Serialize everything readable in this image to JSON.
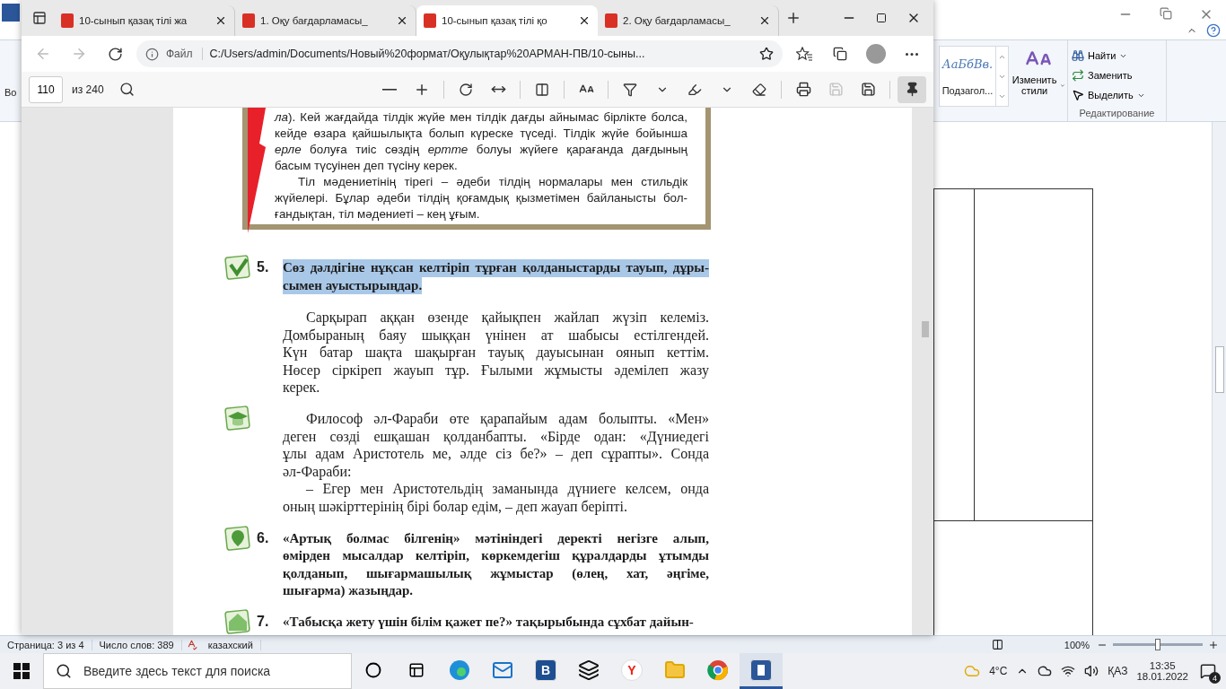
{
  "word": {
    "ribbon": {
      "partial_label": "Во",
      "style_preview": "АаБбВв.",
      "style_name": "Подзагол...",
      "change_styles": "Изменить стили",
      "editing": [
        {
          "label": "Найти",
          "kind": "find",
          "has_menu": true
        },
        {
          "label": "Заменить",
          "kind": "replace",
          "has_menu": false
        },
        {
          "label": "Выделить",
          "kind": "select",
          "has_menu": true
        }
      ],
      "editing_group": "Редактирование"
    }
  },
  "browser": {
    "tabs": [
      {
        "title": "10-сынып қазақ тілі жа",
        "selected": false
      },
      {
        "title": "1. Оқу бағдарламасы_",
        "selected": false
      },
      {
        "title": "10-сынып қазақ тілі қо",
        "selected": true
      },
      {
        "title": "2. Оқу бағдарламасы_",
        "selected": false
      }
    ],
    "address": {
      "label": "Файл",
      "url": "C:/Users/admin/Documents/Новый%20формат/Оқулықтар%20АРМАН-ПВ/10-сыны..."
    },
    "pdf_toolbar": {
      "page": "110",
      "total": "из 240",
      "save_disabled": true,
      "pin_selected": true
    }
  },
  "document": {
    "box_paragraphs": [
      [
        "*ла*). Кей жағдайда тілдік жүйе мен тілдік дағды айнымас бірлікте болса,",
        "кейде өзара қайшылықта болып күреске түседі. Тілдік жүйе бойынша",
        "*ерле* болуға тиіс сөздің *ертте* болуы жүйеге қарағанда дағдының",
        "басым түсуінен деп түсіну керек."
      ],
      [
        "Тіл мәдениетінің тірегі – әдеби тілдің нормалары мен стильдік",
        "жүйелері. Бұлар әдеби тілдің қоғамдық қызметімен байланысты бол-",
        "ғандықтан, тіл мәдениеті – кең ұғым."
      ]
    ],
    "exercises": [
      {
        "kind": "check",
        "number": "5.",
        "highlighted": true,
        "paragraphs": [
          [
            "Сөз дәлдігіне нұқсан келтіріп тұрған қолданыстарды тауып, дұры-",
            "сымен ауыстырыңдар."
          ]
        ]
      },
      {
        "kind": "plain",
        "highlighted": false,
        "paragraphs": [
          [
            "Сарқырап аққан өзенде қайықпен жайлап жүзіп келеміз.",
            "Домбыраның баяу шыққан үнінен ат шабысы естілгендей.",
            "Күн батар шақта шақырған тауық дауысынан оянып кеттім.",
            "Нөсер сіркіреп жауып тұр. Ғылыми жұмысты әдемілеп жазу",
            "керек."
          ]
        ]
      },
      {
        "kind": "cap",
        "highlighted": false,
        "paragraphs": [
          [
            "Философ әл-Фараби өте қарапайым адам болыпты. «Мен»",
            "деген сөзді ешқашан қолданбапты. «Бірде одан: «Дүниедегі",
            "ұлы адам Аристотель ме, әлде сіз бе?» – деп сұрапты». Сонда",
            "әл-Фараби:"
          ],
          [
            "– Егер мен Аристотельдің заманында дүниеге келсем, онда",
            "оның шәкірттерінің бірі болар едім, – деп жауап беріпті."
          ]
        ]
      },
      {
        "kind": "pin",
        "number": "6.",
        "highlighted": false,
        "paragraphs": [
          [
            "«Артық болмас білгенің» мәтініндегі деректі негізге алып,",
            "өмірден мысалдар келтіріп, көркемдегіш құралдарды ұтымды",
            "қолданып, шығармашылық жұмыстар (өлең, хат, әңгіме,",
            "шығарма) жазыңдар."
          ]
        ]
      },
      {
        "kind": "house",
        "number": "7.",
        "highlighted": false,
        "paragraphs": [
          [
            "«Табысқа жету үшін білім қажет пе?» тақырыбында сұхбат дайын-"
          ]
        ]
      }
    ]
  },
  "status_bar": {
    "page": "Страница: 3 из 4",
    "words": "Число слов: 389",
    "language": "казахский",
    "zoom": "100%",
    "zoom_slider": {
      "level": 0.5
    }
  },
  "taskbar": {
    "search_placeholder": "Введите здесь текст для поиска",
    "apps": [
      {
        "kind": "edge",
        "selected": false
      },
      {
        "kind": "mail",
        "selected": false
      },
      {
        "kind": "b",
        "label": "B",
        "selected": false
      },
      {
        "kind": "dropbox",
        "selected": false
      },
      {
        "kind": "yandex",
        "label": "Y",
        "selected": false
      },
      {
        "kind": "explorer",
        "selected": false
      },
      {
        "kind": "chrome",
        "selected": false
      },
      {
        "kind": "word",
        "selected": true
      }
    ],
    "temperature": "4°C",
    "language": "ҚАЗ",
    "time": "13:35",
    "date": "18.01.2022",
    "notifications": "4"
  }
}
